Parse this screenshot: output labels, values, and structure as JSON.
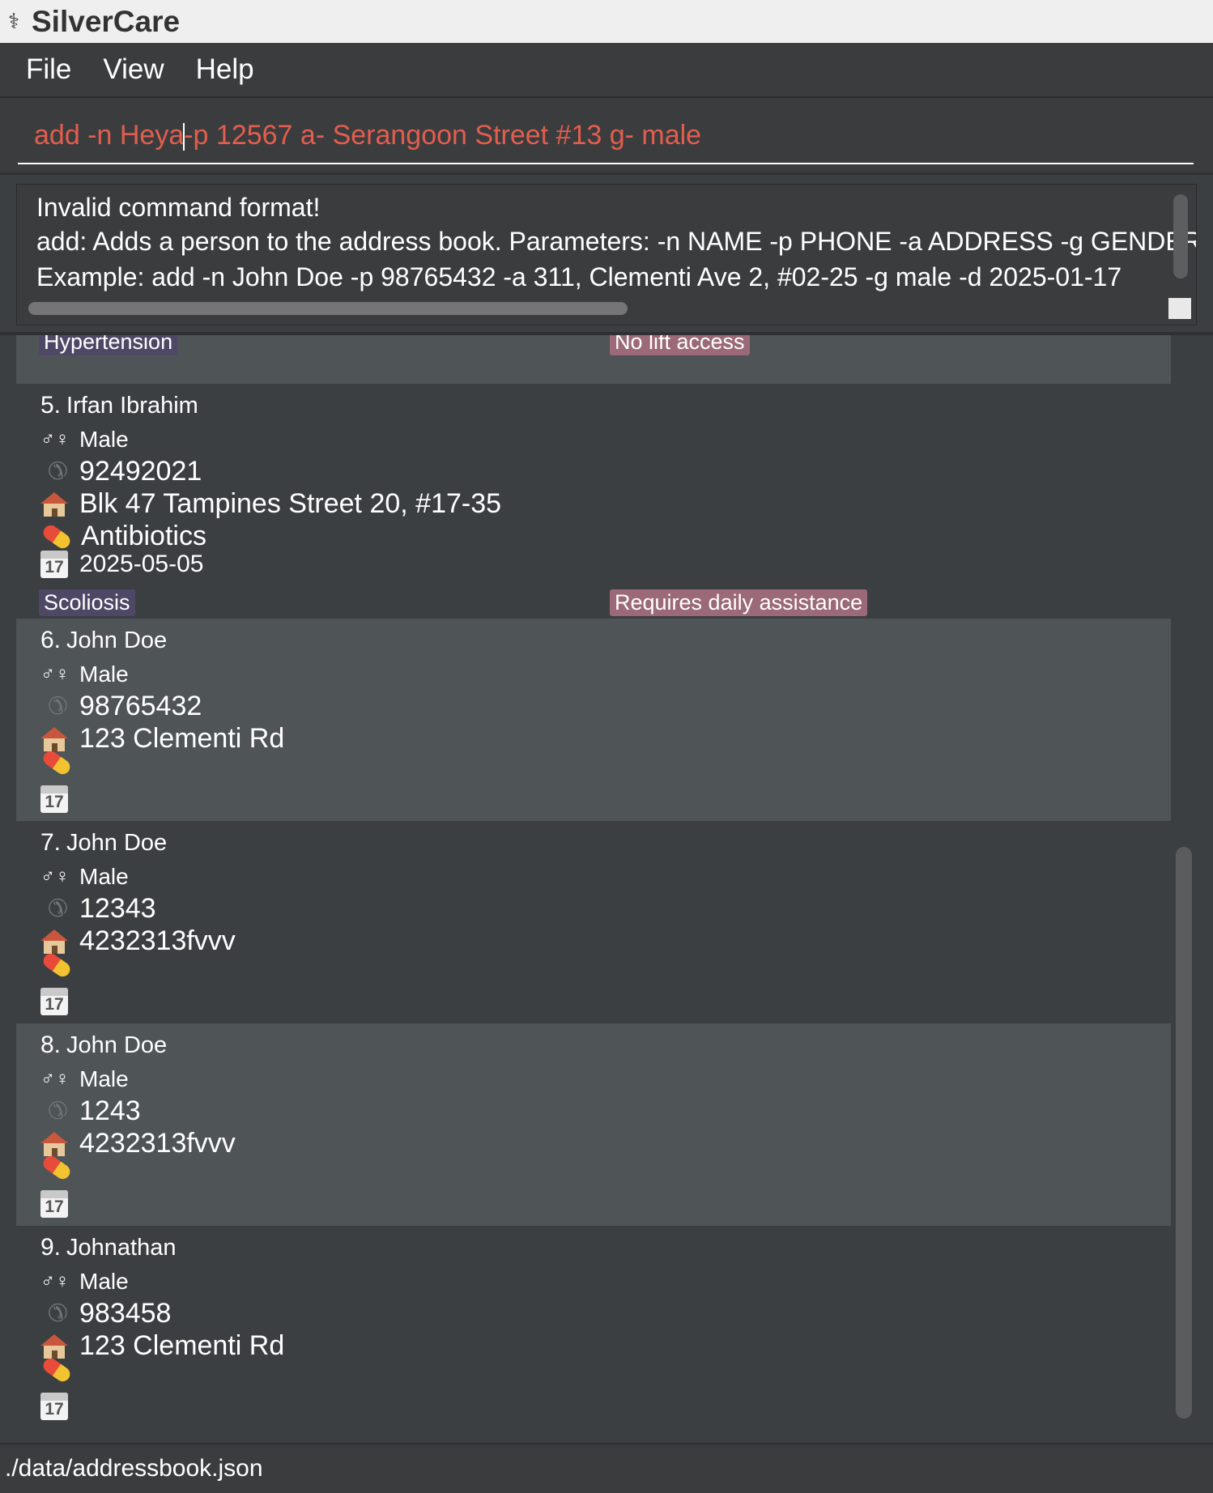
{
  "app": {
    "title": "SilverCare"
  },
  "menu": [
    "File",
    "View",
    "Help"
  ],
  "command": {
    "before_caret": "add -n Heya",
    "after_caret": "-p 12567 a- Serangoon Street #13 g- male"
  },
  "result": {
    "lines": [
      "Invalid command format!",
      "add: Adds a person to the address book. Parameters: -n NAME -p PHONE -a ADDRESS -g GENDER",
      "Example: add -n John Doe -p 98765432 -a 311, Clementi Ave 2, #02-25 -g male -d 2025-01-17"
    ]
  },
  "partial_card": {
    "condition_tag": "Hypertension",
    "note_tag": "No lift access"
  },
  "persons": [
    {
      "index": "5.",
      "name": "Irfan Ibrahim",
      "gender": "Male",
      "phone": "92492021",
      "address": "Blk 47 Tampines Street 20, #17-35",
      "medicine": "Antibiotics",
      "date": "2025-05-05",
      "condition_tag": "Scoliosis",
      "note_tag": "Requires daily assistance"
    },
    {
      "index": "6.",
      "name": "John Doe",
      "gender": "Male",
      "phone": "98765432",
      "address": "123 Clementi Rd",
      "medicine": "",
      "date": ""
    },
    {
      "index": "7.",
      "name": "John Doe",
      "gender": "Male",
      "phone": "12343",
      "address": "4232313fvvv",
      "medicine": "",
      "date": ""
    },
    {
      "index": "8.",
      "name": "John Doe",
      "gender": "Male",
      "phone": "1243",
      "address": "4232313fvvv",
      "medicine": "",
      "date": ""
    },
    {
      "index": "9.",
      "name": "Johnathan",
      "gender": "Male",
      "phone": "983458",
      "address": "123 Clementi Rd",
      "medicine": "",
      "date": ""
    }
  ],
  "icons": {
    "gender": "gender-icon",
    "phone": "phone-icon",
    "address": "house-icon",
    "medicine": "pill-icon",
    "date": "calendar-icon",
    "calendar_day": "17",
    "gender_glyph": "♂♀"
  },
  "status": {
    "path": "./data/addressbook.json"
  },
  "colors": {
    "command_text": "#e35e4e",
    "condition_tag": "#4e4866",
    "note_tag": "#9b6978",
    "alt_row": "#4f5457",
    "row": "#3c3f41"
  }
}
